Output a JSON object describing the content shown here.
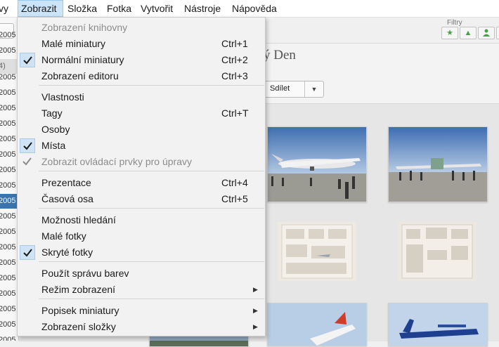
{
  "menubar": {
    "items": [
      "vy",
      "Zobrazit",
      "Složka",
      "Fotka",
      "Vytvořit",
      "Nástroje",
      "Nápověda"
    ]
  },
  "sidebar": {
    "rows": [
      "2005",
      "2005",
      "4)",
      "2005",
      "2005",
      "2005",
      "2005",
      "2005",
      "2005",
      "2005",
      "2005",
      "2005",
      "2005",
      "2005",
      "2005",
      "2005",
      "2005",
      "2005",
      "2005",
      "2005",
      "2005"
    ]
  },
  "main": {
    "filters_label": "Filtry",
    "album_title": "ý Den",
    "share_label": "Sdílet"
  },
  "menu": {
    "items": [
      {
        "label": "Zobrazení knihovny",
        "shortcut": "",
        "checked": false,
        "disabled": true,
        "submenu": false
      },
      {
        "label": "Malé miniatury",
        "shortcut": "Ctrl+1",
        "checked": false,
        "disabled": false,
        "submenu": false
      },
      {
        "label": "Normální miniatury",
        "shortcut": "Ctrl+2",
        "checked": true,
        "disabled": false,
        "submenu": false
      },
      {
        "label": "Zobrazení editoru",
        "shortcut": "Ctrl+3",
        "checked": false,
        "disabled": false,
        "submenu": false
      },
      {
        "label": "Vlastnosti",
        "shortcut": "",
        "checked": false,
        "disabled": false,
        "submenu": false
      },
      {
        "label": "Tagy",
        "shortcut": "Ctrl+T",
        "checked": false,
        "disabled": false,
        "submenu": false
      },
      {
        "label": "Osoby",
        "shortcut": "",
        "checked": false,
        "disabled": false,
        "submenu": false
      },
      {
        "label": "Místa",
        "shortcut": "",
        "checked": true,
        "disabled": false,
        "submenu": false
      },
      {
        "label": "Zobrazit ovládací prvky pro úpravy",
        "shortcut": "",
        "checked": true,
        "disabled": true,
        "submenu": false
      },
      {
        "label": "Prezentace",
        "shortcut": "Ctrl+4",
        "checked": false,
        "disabled": false,
        "submenu": false
      },
      {
        "label": "Časová osa",
        "shortcut": "Ctrl+5",
        "checked": false,
        "disabled": false,
        "submenu": false
      },
      {
        "label": "Možnosti hledání",
        "shortcut": "",
        "checked": false,
        "disabled": false,
        "submenu": false
      },
      {
        "label": "Malé fotky",
        "shortcut": "",
        "checked": false,
        "disabled": false,
        "submenu": false
      },
      {
        "label": "Skryté fotky",
        "shortcut": "",
        "checked": true,
        "disabled": false,
        "submenu": false
      },
      {
        "label": "Použít správu barev",
        "shortcut": "",
        "checked": false,
        "disabled": false,
        "submenu": false
      },
      {
        "label": "Režim zobrazení",
        "shortcut": "",
        "checked": false,
        "disabled": false,
        "submenu": true
      },
      {
        "label": "Popisek miniatury",
        "shortcut": "",
        "checked": false,
        "disabled": false,
        "submenu": true
      },
      {
        "label": "Zobrazení složky",
        "shortcut": "",
        "checked": false,
        "disabled": false,
        "submenu": true
      }
    ]
  },
  "colors": {
    "menu_highlight": "#cce4f7",
    "sidebar_selected": "#3a74ad",
    "filter_icon": "#4aa04a"
  }
}
